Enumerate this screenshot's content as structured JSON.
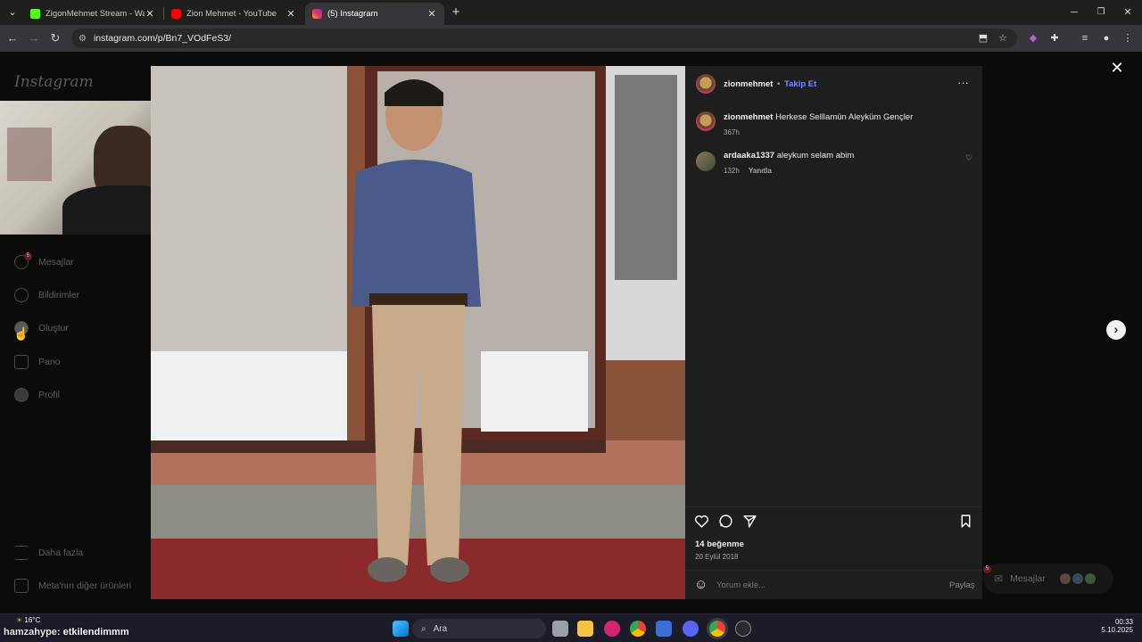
{
  "browser": {
    "tabs": [
      {
        "title": "ZigonMehmet Stream - Watch Live",
        "favicon_color": "#53fc18",
        "active": false
      },
      {
        "title": "Zion Mehmet - YouTube",
        "favicon_color": "#ff0000",
        "active": false
      },
      {
        "title": "(5) Instagram",
        "favicon_color": "#e1306c",
        "active": true
      }
    ],
    "new_tab_label": "+",
    "url": "instagram.com/p/Bn7_VOdFeS3/"
  },
  "instagram": {
    "logo": "Instagram",
    "sidebar": [
      {
        "label": "Mesajlar",
        "icon": "messenger-icon",
        "badge": "5"
      },
      {
        "label": "Bildirimler",
        "icon": "heart-icon"
      },
      {
        "label": "Oluştur",
        "icon": "plus-icon"
      },
      {
        "label": "Pano",
        "icon": "chart-icon"
      },
      {
        "label": "Profil",
        "icon": "profile-icon"
      }
    ],
    "sidebar_bottom": [
      {
        "label": "Daha fazla",
        "icon": "menu-icon"
      },
      {
        "label": "Meta'nın diğer ürünleri",
        "icon": "grid-icon"
      }
    ],
    "post": {
      "author": "zionmehmet",
      "separator": "•",
      "follow_label": "Takip Et",
      "more_label": "···",
      "caption_user": "zionmehmet",
      "caption_text": "Herkese Selllamün Aleyküm Gençler",
      "caption_time": "367h",
      "comments": [
        {
          "user": "ardaaka1337",
          "text": "aleykum selam abim",
          "time": "132h",
          "reply_label": "Yanıtla"
        }
      ],
      "likes": "14 beğenme",
      "date": "20 Eylül 2018",
      "comment_placeholder": "Yorum ekle...",
      "share_label": "Paylaş"
    },
    "messages_pill": "Mesajlar",
    "messages_badge": "5"
  },
  "overlay": {
    "chat_user": "hamzahype",
    "chat_text": "etkilendimmm",
    "weather": "16°C"
  },
  "taskbar": {
    "search_placeholder": "Ara",
    "time": "00:33",
    "date": "5.10.2025"
  }
}
